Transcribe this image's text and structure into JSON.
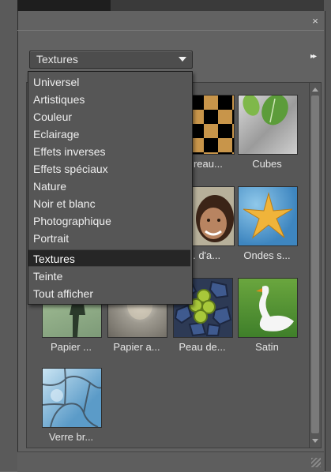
{
  "panel": {
    "close_symbol": "×",
    "menu_symbol": "▸▸"
  },
  "category_select": {
    "value": "Textures",
    "options": [
      "Universel",
      "Artistiques",
      "Couleur",
      "Eclairage",
      "Effets inverses",
      "Effets spéciaux",
      "Nature",
      "Noir et blanc",
      "Photographique",
      "Portrait",
      "Textures",
      "Teinte",
      "Tout afficher"
    ],
    "selected_index": 10
  },
  "thumbnails": [
    {
      "caption": "...reau...",
      "icon": "checkerboard-thumbnail"
    },
    {
      "caption": "Cubes",
      "icon": "leaf-cubes-thumbnail"
    },
    {
      "caption": "... d'a...",
      "icon": "portrait-child-thumbnail"
    },
    {
      "caption": "Ondes s...",
      "icon": "starfish-waves-thumbnail"
    },
    {
      "caption": "Papier ...",
      "icon": "papier-thumbnail"
    },
    {
      "caption": "Papier a...",
      "icon": "papier-aluminium-thumbnail"
    },
    {
      "caption": "Peau de...",
      "icon": "peau-thumbnail"
    },
    {
      "caption": "Satin",
      "icon": "swan-satin-thumbnail"
    },
    {
      "caption": "Verre br...",
      "icon": "broken-glass-thumbnail"
    }
  ],
  "colors": {
    "panel_bg": "#626262",
    "selection_bg": "#262626"
  }
}
